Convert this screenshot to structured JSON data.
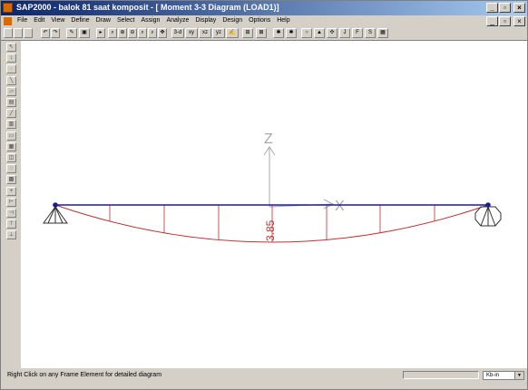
{
  "window": {
    "title": "SAP2000 - balok 81 saat komposit - [ Moment 3-3 Diagram  (LOAD1)]",
    "minimize": "_",
    "restore": "▫",
    "close": "×"
  },
  "menubar": {
    "items": [
      "File",
      "Edit",
      "View",
      "Define",
      "Draw",
      "Select",
      "Assign",
      "Analyze",
      "Display",
      "Design",
      "Options",
      "Help"
    ]
  },
  "toolbar": {
    "items": [
      {
        "icon": "new-file-icon",
        "glyph": ""
      },
      {
        "icon": "open-folder-icon",
        "glyph": ""
      },
      {
        "icon": "save-icon",
        "glyph": ""
      },
      {
        "icon": "undo-icon",
        "glyph": "↶"
      },
      {
        "icon": "redo-icon",
        "glyph": "↷"
      },
      {
        "icon": "pencil-icon",
        "glyph": "✎"
      },
      {
        "icon": "refresh-window-icon",
        "glyph": "▣"
      },
      {
        "icon": "pointer-icon",
        "glyph": "▸"
      },
      {
        "icon": "zoom-window-icon",
        "glyph": "⌕"
      },
      {
        "icon": "zoom-in-icon",
        "glyph": "⊕"
      },
      {
        "icon": "zoom-out-icon",
        "glyph": "⊖"
      },
      {
        "icon": "zoom-restore-icon",
        "glyph": "⌕"
      },
      {
        "icon": "zoom-previous-icon",
        "glyph": "⌕"
      },
      {
        "icon": "pan-icon",
        "glyph": "✥"
      },
      {
        "icon": "view-3d-icon",
        "glyph": "3-d"
      },
      {
        "icon": "view-xy-icon",
        "glyph": "xy"
      },
      {
        "icon": "view-xz-icon",
        "glyph": "xz"
      },
      {
        "icon": "view-yz-icon",
        "glyph": "yz"
      },
      {
        "icon": "rubber-band-icon",
        "glyph": "✍"
      },
      {
        "icon": "element-shrink-icon",
        "glyph": "⊞"
      },
      {
        "icon": "show-deformed-icon",
        "glyph": "⊠"
      },
      {
        "icon": "move-up-icon",
        "glyph": "✱"
      },
      {
        "icon": "move-down-icon",
        "glyph": "✱"
      },
      {
        "icon": "joint-reactions-icon",
        "glyph": "○"
      },
      {
        "icon": "show-deformed-shape-icon",
        "glyph": "▲"
      },
      {
        "icon": "show-forces-icon",
        "glyph": "✣"
      },
      {
        "icon": "member-forces-icon",
        "glyph": "J"
      },
      {
        "icon": "frame-forces-icon",
        "glyph": "F"
      },
      {
        "icon": "design-icon",
        "glyph": "S"
      },
      {
        "icon": "table-icon",
        "glyph": "▦"
      }
    ]
  },
  "sidebar": {
    "tools": [
      {
        "icon": "select-pointer-icon",
        "glyph": "↖"
      },
      {
        "icon": "reshape-icon",
        "glyph": "↕"
      },
      {
        "icon": "draw-joint-icon",
        "glyph": "·"
      },
      {
        "icon": "draw-frame-icon",
        "glyph": "╲"
      },
      {
        "icon": "draw-shell-icon",
        "glyph": "▱"
      },
      {
        "icon": "quick-draw-icon",
        "glyph": "▤"
      },
      {
        "icon": "draw-line-icon",
        "glyph": "╱"
      },
      {
        "icon": "quick-frame-icon",
        "glyph": "▥"
      },
      {
        "icon": "rectangle-shell-icon",
        "glyph": "▭"
      },
      {
        "icon": "select-all-icon",
        "glyph": "▦"
      },
      {
        "icon": "get-previous-icon",
        "glyph": "◫"
      },
      {
        "icon": "clear-selection-icon",
        "glyph": "◌"
      },
      {
        "icon": "intersecting-line-icon",
        "glyph": "▩"
      },
      {
        "icon": "snap-joint-icon",
        "glyph": "+"
      },
      {
        "icon": "snap-end-icon",
        "glyph": "⊢"
      },
      {
        "icon": "snap-middle-icon",
        "glyph": "⊣"
      },
      {
        "icon": "snap-intersection-icon",
        "glyph": "⊤"
      },
      {
        "icon": "snap-perpendicular-icon",
        "glyph": "⊥"
      }
    ]
  },
  "diagram": {
    "axis_z_label": "Z",
    "axis_x_label": "X",
    "max_moment_label": "3.85",
    "beam_color": "#1a1aa0",
    "moment_color": "#c03030",
    "axis_color": "#a8a8a8",
    "support_color": "#303030"
  },
  "status": {
    "message": "Right Click on any Frame Element for detailed diagram",
    "units": "Kb-in"
  }
}
